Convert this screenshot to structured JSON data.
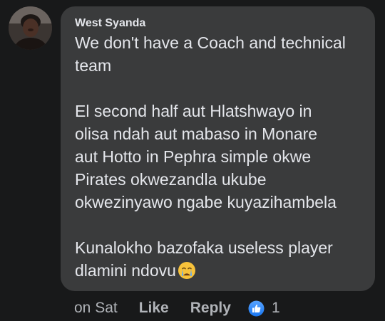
{
  "comment": {
    "author": "West Syanda",
    "paragraphs": [
      [
        "We don't have a  Coach and technical",
        "team"
      ],
      [
        "El second half  aut Hlatshwayo   in",
        "olisa ndah  aut  mabaso in Monare",
        "aut Hotto  in  Pephra  simple  okwe",
        "Pirates  okwezandla ukube",
        "okwezinyawo ngabe kuyazihambela"
      ],
      [
        "Kunalokho bazofaka useless player",
        "dlamini  ndovu"
      ]
    ],
    "trailing_emoji": "crying-face-icon"
  },
  "actions": {
    "timestamp": "on Sat",
    "like_label": "Like",
    "reply_label": "Reply",
    "reaction_icon": "like-reaction-icon",
    "reaction_count": "1"
  },
  "colors": {
    "background": "#18191a",
    "bubble": "#3a3b3c",
    "text": "#e4e6eb",
    "secondary_text": "#b0b3b8",
    "like_blue": "#2d88ff"
  }
}
